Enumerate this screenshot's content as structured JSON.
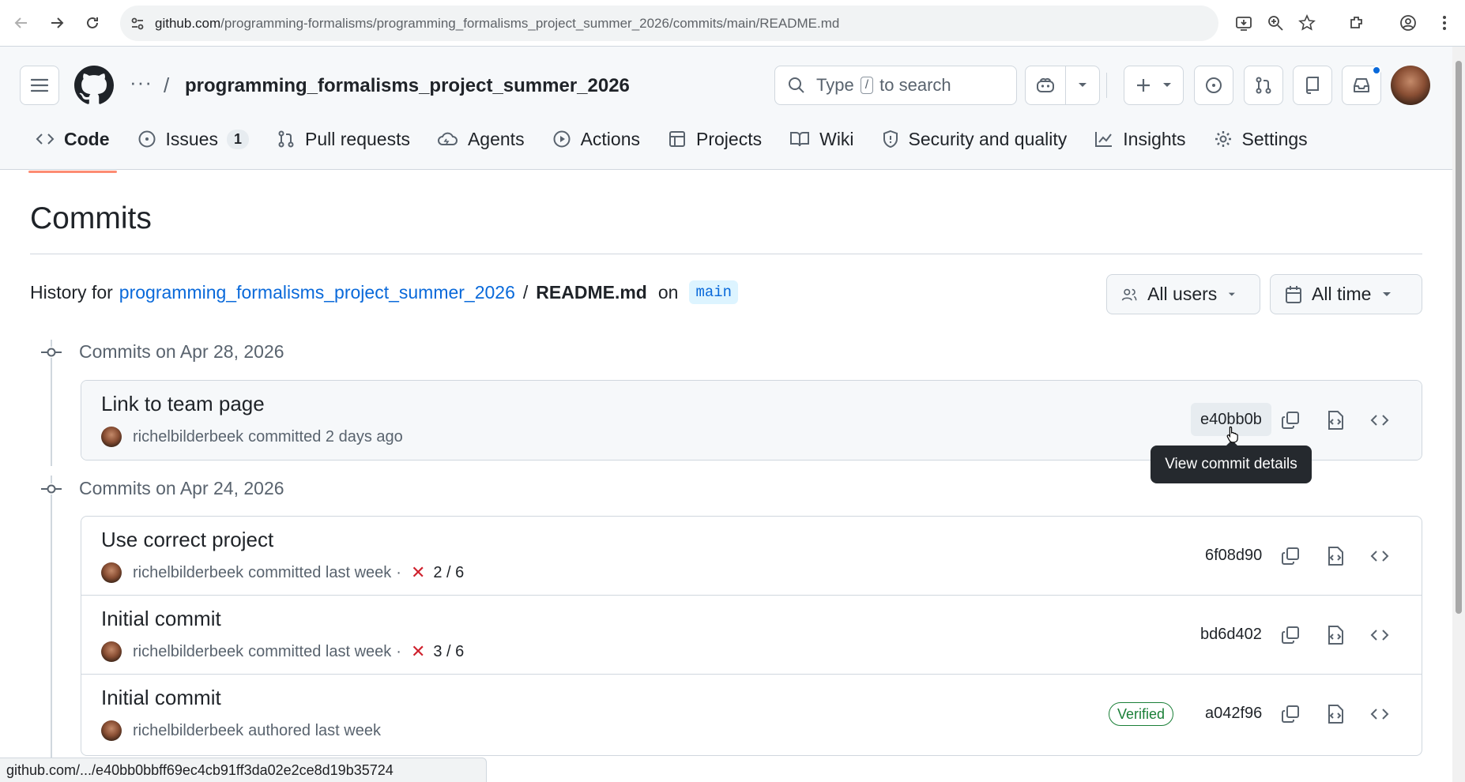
{
  "browser": {
    "url_host": "github.com",
    "url_path": "/programming-formalisms/programming_formalisms_project_summer_2026/commits/main/README.md",
    "status_url": "github.com/.../e40bb0bbff69ec4cb91ff3da02e2ce8d19b35724"
  },
  "header": {
    "repo_name": "programming_formalisms_project_summer_2026",
    "search_prefix": "Type",
    "search_key": "/",
    "search_suffix": "to search"
  },
  "tabs": [
    {
      "label": "Code",
      "icon": "code-icon",
      "active": true
    },
    {
      "label": "Issues",
      "icon": "issue-icon",
      "count": "1"
    },
    {
      "label": "Pull requests",
      "icon": "pull-request-icon"
    },
    {
      "label": "Agents",
      "icon": "agent-icon"
    },
    {
      "label": "Actions",
      "icon": "play-icon"
    },
    {
      "label": "Projects",
      "icon": "table-icon"
    },
    {
      "label": "Wiki",
      "icon": "book-icon"
    },
    {
      "label": "Security and quality",
      "icon": "shield-icon"
    },
    {
      "label": "Insights",
      "icon": "graph-icon"
    },
    {
      "label": "Settings",
      "icon": "gear-icon"
    }
  ],
  "main": {
    "title": "Commits",
    "history_prefix": "History for",
    "history_repo": "programming_formalisms_project_summer_2026",
    "history_sep": "/",
    "history_file": "README.md",
    "history_on": "on",
    "branch": "main",
    "filter_users": "All users",
    "filter_time": "All time"
  },
  "groups": [
    {
      "date_label": "Commits on Apr 28, 2026",
      "commits": [
        {
          "title": "Link to team page",
          "author": "richelbilderbeek",
          "action": "committed",
          "when": "2 days ago",
          "checks": "",
          "verified": "",
          "sha": "e40bb0b"
        }
      ]
    },
    {
      "date_label": "Commits on Apr 24, 2026",
      "commits": [
        {
          "title": "Use correct project",
          "author": "richelbilderbeek",
          "action": "committed",
          "when": "last week",
          "checks": "2 / 6",
          "verified": "",
          "sha": "6f08d90"
        },
        {
          "title": "Initial commit",
          "author": "richelbilderbeek",
          "action": "committed",
          "when": "last week",
          "checks": "3 / 6",
          "verified": "",
          "sha": "bd6d402"
        },
        {
          "title": "Initial commit",
          "author": "richelbilderbeek",
          "action": "authored",
          "when": "last week",
          "checks": "",
          "verified": "Verified",
          "sha": "a042f96"
        }
      ]
    }
  ],
  "tooltip": "View commit details",
  "colors": {
    "link": "#0969da",
    "failure": "#cf222e",
    "success": "#1a7f37",
    "active_tab_underline": "#fd8c73"
  }
}
